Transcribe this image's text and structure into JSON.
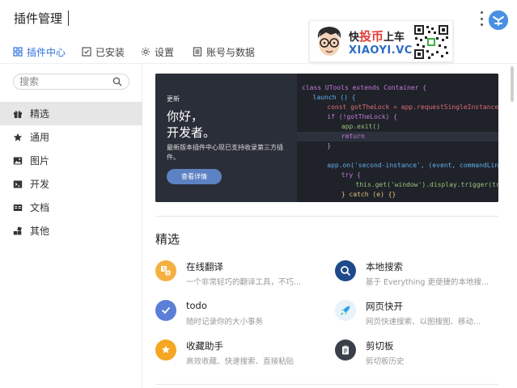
{
  "app": {
    "title": "插件管理"
  },
  "tabs": [
    {
      "label": "插件中心",
      "icon": "grid-icon",
      "active": true
    },
    {
      "label": "已安装",
      "icon": "check-square-icon",
      "active": false
    },
    {
      "label": "设置",
      "icon": "gear-icon",
      "active": false
    },
    {
      "label": "账号与数据",
      "icon": "list-icon",
      "active": false
    }
  ],
  "watermark": {
    "line1_pre": "快",
    "line1_hl": "投币",
    "line1_post": "上车",
    "line2": "XIAOYI.VC"
  },
  "search": {
    "placeholder": "搜索"
  },
  "sidebar": {
    "items": [
      {
        "label": "精选",
        "icon": "gift-icon",
        "active": true
      },
      {
        "label": "通用",
        "icon": "star-icon",
        "active": false
      },
      {
        "label": "图片",
        "icon": "image-icon",
        "active": false
      },
      {
        "label": "开发",
        "icon": "terminal-icon",
        "active": false
      },
      {
        "label": "文档",
        "icon": "document-icon",
        "active": false
      },
      {
        "label": "其他",
        "icon": "blocks-icon",
        "active": false
      }
    ]
  },
  "banner": {
    "tag": "更新",
    "title_line1": "你好，",
    "title_line2": "开发者。",
    "desc": "最新版本插件中心现已支持收录第三方插件。",
    "button": "查看详情",
    "code": [
      "class UTools extends Container {",
      "  launch () {",
      "    const gotTheLock = app.requestSingleInstanceL",
      "    if (!gotTheLock) {",
      "      app.exit()",
      "      return",
      "    }",
      "",
      "    app.on('second-instance', (event, commandLine",
      "      try {",
      "        this.get('window').display.trigger(true)",
      "      } catch (e) {}"
    ]
  },
  "section": {
    "title": "精选"
  },
  "plugins": [
    {
      "name": "在线翻译",
      "desc": "一个非常轻巧的翻译工具，不巧...",
      "icon": "translate-icon",
      "color": "#f5b041"
    },
    {
      "name": "本地搜索",
      "desc": "基于 Everything 更便捷的本地搜...",
      "icon": "magnifier-icon",
      "color": "#1e4a8c"
    },
    {
      "name": "todo",
      "desc": "随时记录你的大小事务",
      "icon": "check-icon",
      "color": "#5b7fd6"
    },
    {
      "name": "网页快开",
      "desc": "网页快速搜索、以图搜图、移动...",
      "icon": "rocket-icon",
      "color": "#e8f2f8"
    },
    {
      "name": "收藏助手",
      "desc": "高效收藏、快速搜索、直接粘贴",
      "icon": "bookmark-star-icon",
      "color": "#f5a623"
    },
    {
      "name": "剪切板",
      "desc": "剪切板历史",
      "icon": "clipboard-icon",
      "color": "#3a3f4a"
    }
  ]
}
